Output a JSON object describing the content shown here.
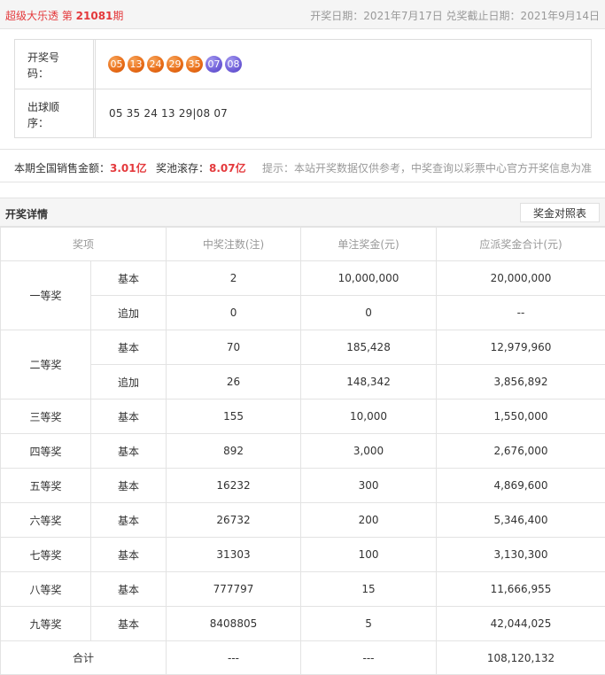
{
  "header": {
    "lottery_name": "超级大乐透 第 ",
    "issue": "21081",
    "issue_suffix": "期",
    "dates": "开奖日期：2021年7月17日 兑奖截止日期：2021年9月14日"
  },
  "draw": {
    "numbers_label_line1": "开奖号",
    "numbers_label_line2": "码：",
    "red_balls": [
      "05",
      "13",
      "24",
      "29",
      "35"
    ],
    "blue_balls": [
      "07",
      "08"
    ],
    "order_label_line1": "出球顺",
    "order_label_line2": "序：",
    "order_text": "05 35 24 13 29|08 07"
  },
  "sales": {
    "sales_label": "本期全国销售金额：",
    "sales_value": "3.01亿",
    "pool_label": "奖池滚存：",
    "pool_value": "8.07亿",
    "tip": "提示：本站开奖数据仅供参考，中奖查询以彩票中心官方开奖信息为准"
  },
  "details": {
    "title": "开奖详情",
    "compare_button": "奖金对照表",
    "columns": [
      "奖项",
      "中奖注数(注)",
      "单注奖金(元)",
      "应派奖金合计(元)"
    ],
    "rows": [
      {
        "prize": "一等奖",
        "type": "基本",
        "count": "2",
        "single": "10,000,000",
        "total": "20,000,000"
      },
      {
        "prize": "",
        "type": "追加",
        "count": "0",
        "single": "0",
        "total": "--"
      },
      {
        "prize": "二等奖",
        "type": "基本",
        "count": "70",
        "single": "185,428",
        "total": "12,979,960"
      },
      {
        "prize": "",
        "type": "追加",
        "count": "26",
        "single": "148,342",
        "total": "3,856,892"
      },
      {
        "prize": "三等奖",
        "type": "基本",
        "count": "155",
        "single": "10,000",
        "total": "1,550,000"
      },
      {
        "prize": "四等奖",
        "type": "基本",
        "count": "892",
        "single": "3,000",
        "total": "2,676,000"
      },
      {
        "prize": "五等奖",
        "type": "基本",
        "count": "16232",
        "single": "300",
        "total": "4,869,600"
      },
      {
        "prize": "六等奖",
        "type": "基本",
        "count": "26732",
        "single": "200",
        "total": "5,346,400"
      },
      {
        "prize": "七等奖",
        "type": "基本",
        "count": "31303",
        "single": "100",
        "total": "3,130,300"
      },
      {
        "prize": "八等奖",
        "type": "基本",
        "count": "777797",
        "single": "15",
        "total": "11,666,955"
      },
      {
        "prize": "九等奖",
        "type": "基本",
        "count": "8408805",
        "single": "5",
        "total": "42,044,025"
      }
    ],
    "summary": {
      "label": "合计",
      "count": "---",
      "single": "---",
      "total": "108,120,132"
    }
  },
  "colors": {
    "accent_red": "#e4393c",
    "red_ball": "#e86c17",
    "blue_ball": "#6f5ed8"
  }
}
